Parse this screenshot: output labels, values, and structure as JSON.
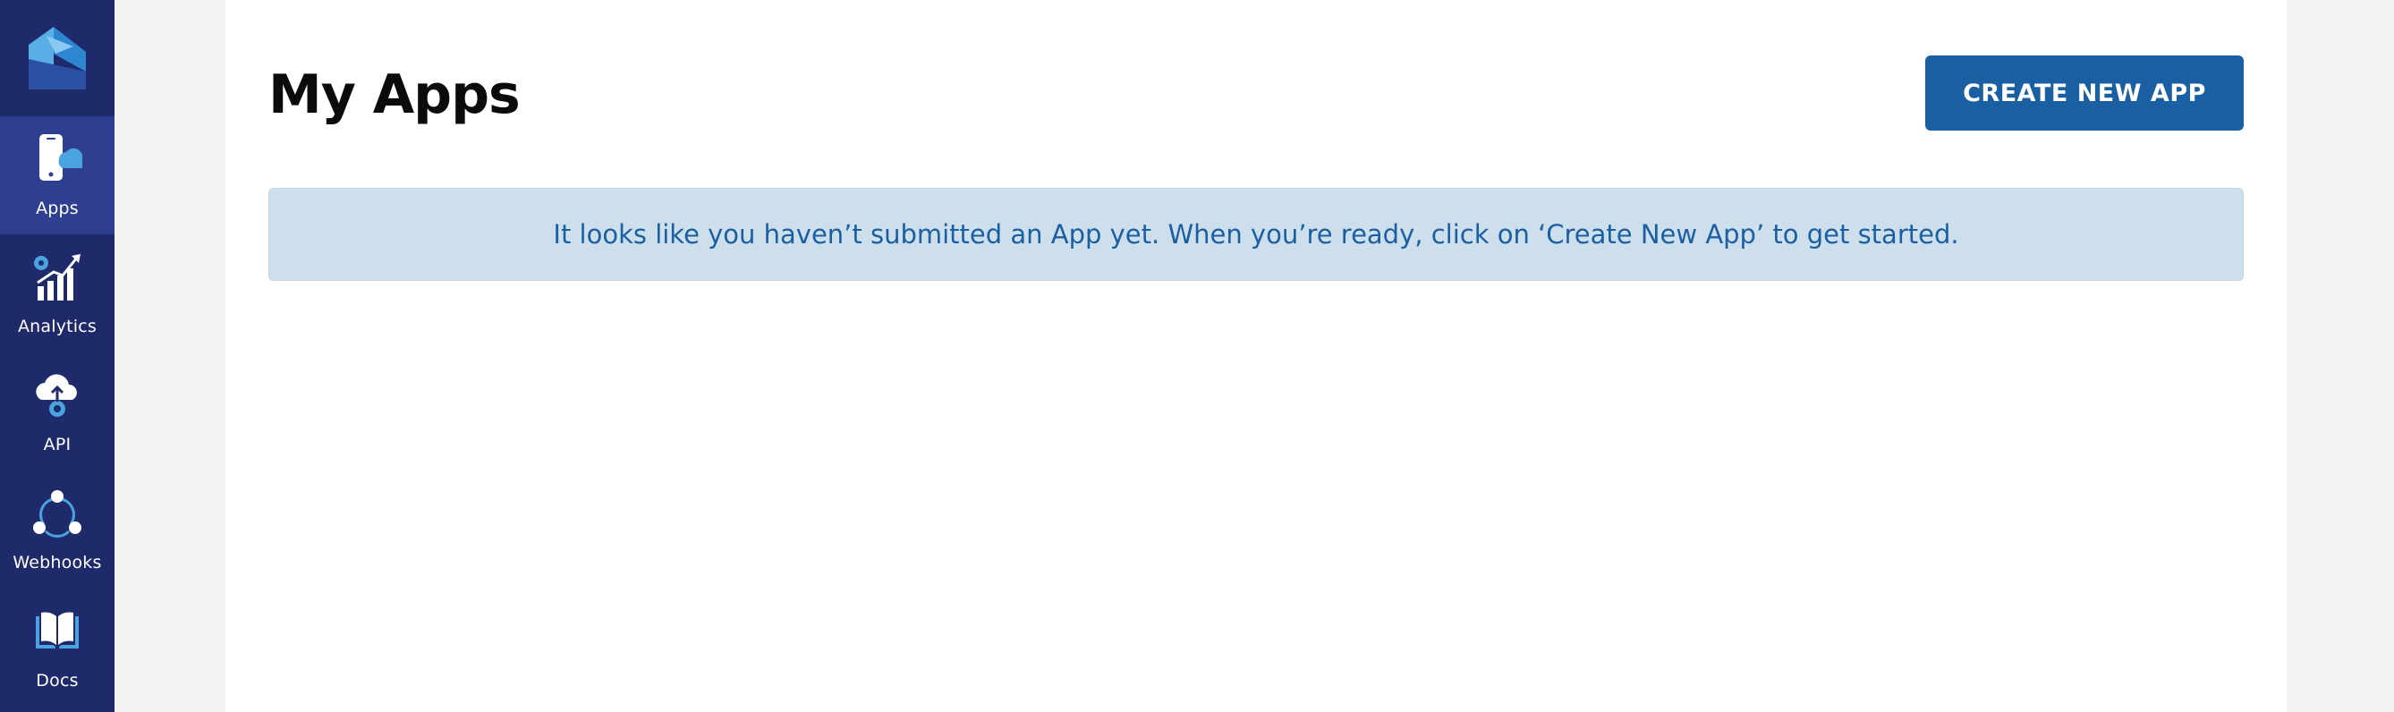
{
  "sidebar": {
    "logo_icon": "brand-logo-icon",
    "items": [
      {
        "label": "Apps",
        "icon": "phone-cloud-icon",
        "active": true
      },
      {
        "label": "Analytics",
        "icon": "analytics-chart-icon",
        "active": false
      },
      {
        "label": "API",
        "icon": "cloud-upload-icon",
        "active": false
      },
      {
        "label": "Webhooks",
        "icon": "webhooks-icon",
        "active": false
      },
      {
        "label": "Docs",
        "icon": "book-icon",
        "active": false
      }
    ]
  },
  "main": {
    "title": "My Apps",
    "create_button_label": "CREATE NEW APP",
    "notice_text": "It looks like you haven’t submitted an App yet. When you’re ready, click on ‘Create New App’ to get started."
  },
  "colors": {
    "sidebar_bg": "#1f2a6b",
    "sidebar_active_bg": "#2f3f8f",
    "accent_blue": "#1b5fa3",
    "light_blue_icon": "#4aa3df",
    "notice_bg": "#cddfeb",
    "page_bg": "#f2f2f2",
    "card_bg": "#ffffff"
  }
}
